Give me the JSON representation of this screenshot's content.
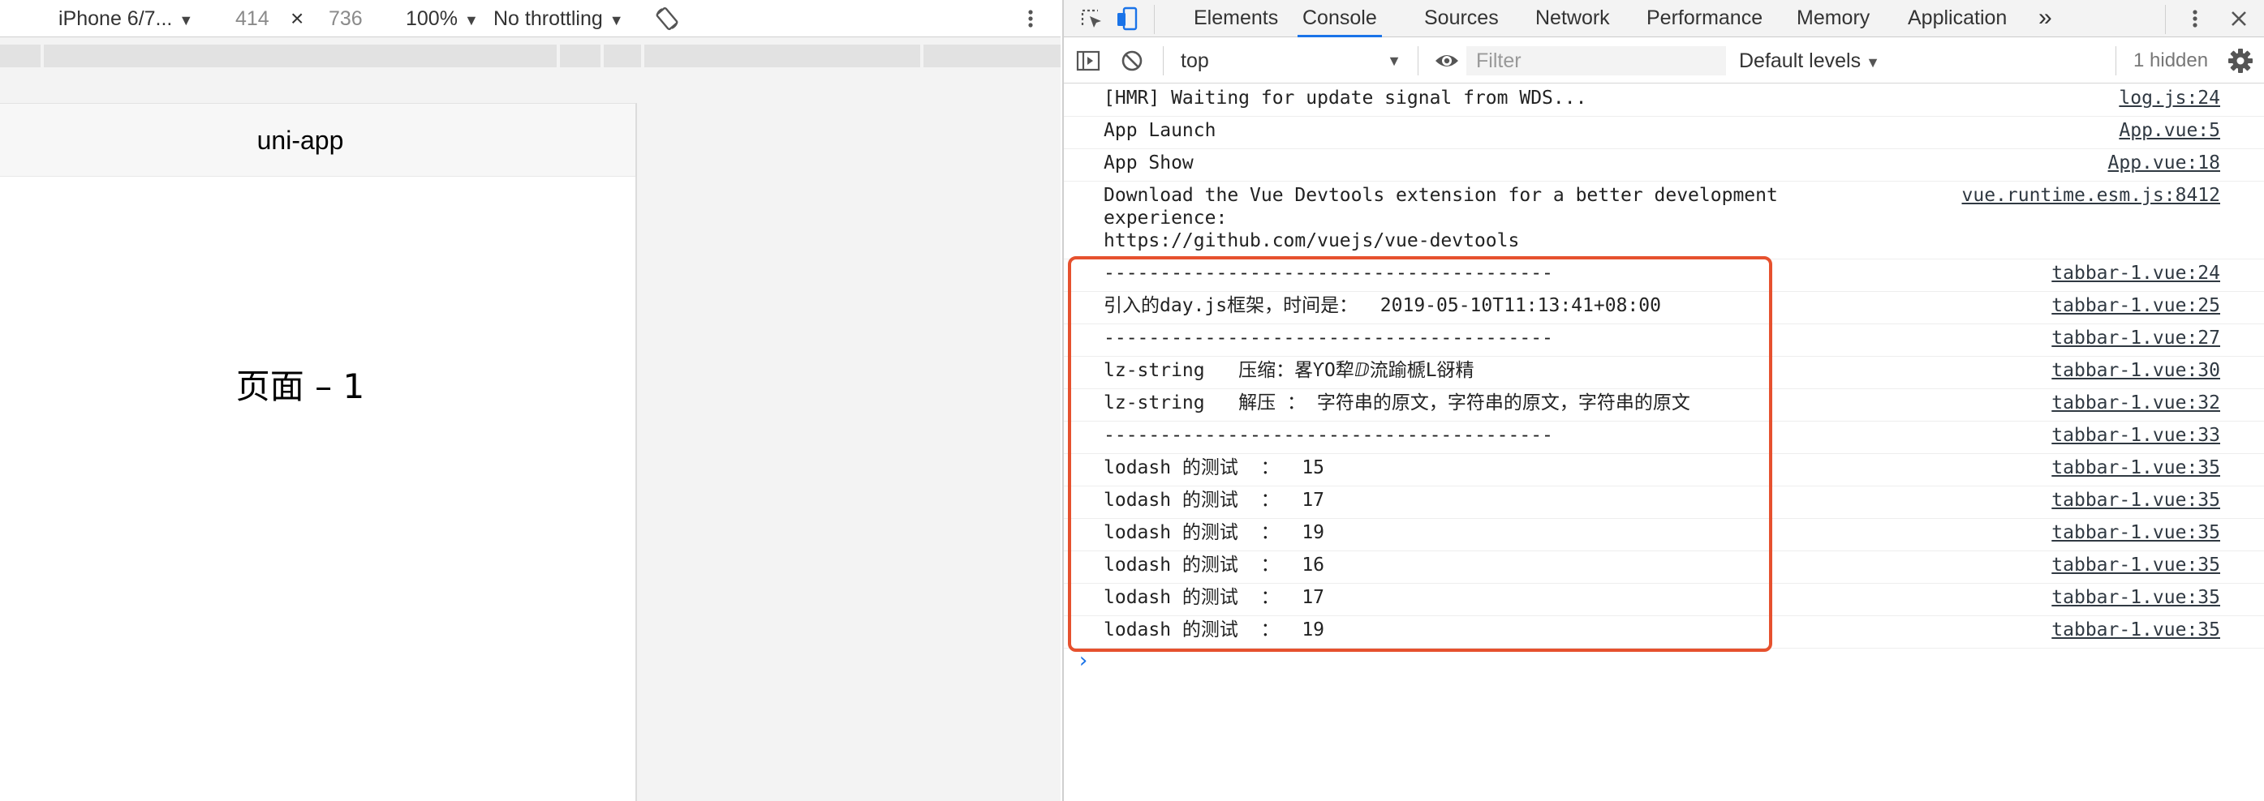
{
  "device_toolbar": {
    "device": "iPhone 6/7...",
    "width": "414",
    "times": "×",
    "height": "736",
    "zoom": "100%",
    "throttle": "No throttling"
  },
  "app": {
    "nav_title": "uni-app",
    "page_text": "页面 – 1"
  },
  "devtools": {
    "tabs": [
      "Elements",
      "Console",
      "Sources",
      "Network",
      "Performance",
      "Memory",
      "Application"
    ],
    "active_tab": "Console",
    "more_tabs": "»",
    "context": "top",
    "filter_placeholder": "Filter",
    "levels": "Default levels",
    "hidden": "1 hidden"
  },
  "console": {
    "rows": [
      {
        "msg": "[HMR] Waiting for update signal from WDS...",
        "src": "log.js:24"
      },
      {
        "msg": "App Launch",
        "src": "App.vue:5"
      },
      {
        "msg": "App Show",
        "src": "App.vue:18"
      },
      {
        "msg": "Download the Vue Devtools extension for a better development\nexperience:\nhttps://github.com/vuejs/vue-devtools",
        "src": "vue.runtime.esm.js:8412"
      },
      {
        "msg": "----------------------------------------",
        "src": "tabbar-1.vue:24"
      },
      {
        "msg": "引入的day.js框架，时间是：  2019-05-10T11:13:41+08:00",
        "src": "tabbar-1.vue:25"
      },
      {
        "msg": "----------------------------------------",
        "src": "tabbar-1.vue:27"
      },
      {
        "msg": "lz-string   压缩：畧ƳO犂ⅅ流踰榹L谺精",
        "src": "tabbar-1.vue:30"
      },
      {
        "msg": "lz-string   解压 ： 字符串的原文，字符串的原文，字符串的原文",
        "src": "tabbar-1.vue:32"
      },
      {
        "msg": "----------------------------------------",
        "src": "tabbar-1.vue:33"
      },
      {
        "msg": "lodash 的测试  ：  15",
        "src": "tabbar-1.vue:35"
      },
      {
        "msg": "lodash 的测试  ：  17",
        "src": "tabbar-1.vue:35"
      },
      {
        "msg": "lodash 的测试  ：  19",
        "src": "tabbar-1.vue:35"
      },
      {
        "msg": "lodash 的测试  ：  16",
        "src": "tabbar-1.vue:35"
      },
      {
        "msg": "lodash 的测试  ：  17",
        "src": "tabbar-1.vue:35"
      },
      {
        "msg": "lodash 的测试  ：  19",
        "src": "tabbar-1.vue:35"
      }
    ],
    "prompt": "›"
  },
  "icons": {
    "rotate": "rotate-icon",
    "device_more": "more-vertical-icon",
    "inspect": "inspect-element-icon",
    "device_mode": "device-toggle-icon",
    "devtools_more": "more-vertical-icon",
    "close": "close-icon",
    "sidebar": "sidebar-toggle-icon",
    "clear": "clear-console-icon",
    "eye": "eye-icon",
    "settings": "gear-icon"
  },
  "colors": {
    "accent": "#1a73e8",
    "highlight_box": "#e6512e"
  }
}
